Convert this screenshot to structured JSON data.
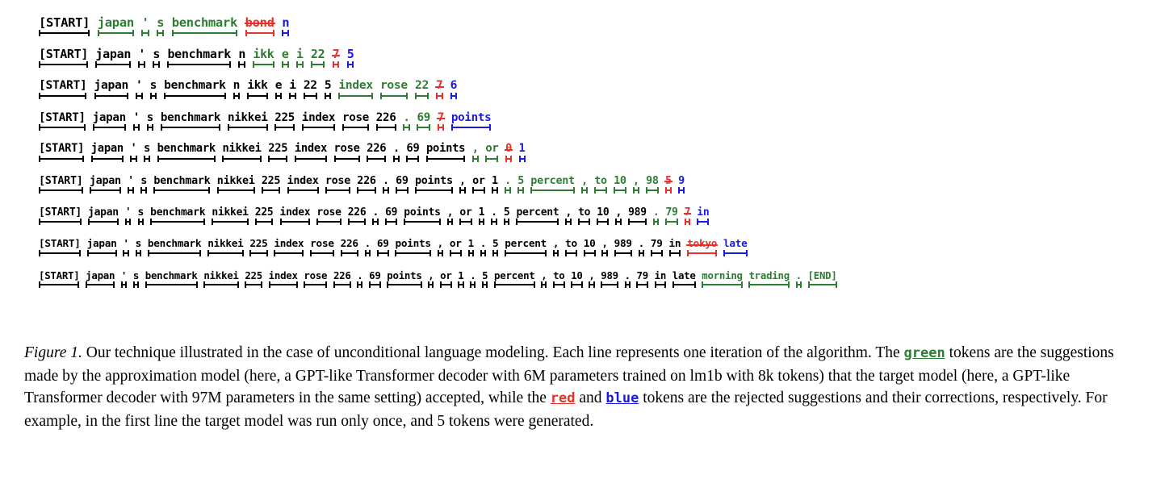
{
  "figure": {
    "label": "Figure 1.",
    "colors": {
      "accepted_green": "#2e7d32",
      "rejected_red": "#e8312a",
      "correction_blue": "#1a1ae0",
      "context_black": "#000000"
    },
    "rows": [
      {
        "index": 1,
        "font_size": 15.5,
        "tokens": [
          {
            "text": "[START]",
            "color": "black"
          },
          {
            "text": "japan",
            "color": "green"
          },
          {
            "text": "'",
            "color": "green"
          },
          {
            "text": "s",
            "color": "green"
          },
          {
            "text": "benchmark",
            "color": "green"
          },
          {
            "text": "bond",
            "color": "red",
            "strike": true
          },
          {
            "text": "n",
            "color": "blue"
          }
        ]
      },
      {
        "index": 2,
        "font_size": 15.0,
        "tokens": [
          {
            "text": "[START]",
            "color": "black"
          },
          {
            "text": "japan",
            "color": "black"
          },
          {
            "text": "'",
            "color": "black"
          },
          {
            "text": "s",
            "color": "black"
          },
          {
            "text": "benchmark",
            "color": "black"
          },
          {
            "text": "n",
            "color": "black"
          },
          {
            "text": "ikk",
            "color": "green"
          },
          {
            "text": "e",
            "color": "green"
          },
          {
            "text": "i",
            "color": "green"
          },
          {
            "text": "22",
            "color": "green"
          },
          {
            "text": "7",
            "color": "red",
            "strike": true
          },
          {
            "text": "5",
            "color": "blue"
          }
        ]
      },
      {
        "index": 3,
        "font_size": 14.6,
        "tokens": [
          {
            "text": "[START]",
            "color": "black"
          },
          {
            "text": "japan",
            "color": "black"
          },
          {
            "text": "'",
            "color": "black"
          },
          {
            "text": "s",
            "color": "black"
          },
          {
            "text": "benchmark",
            "color": "black"
          },
          {
            "text": "n",
            "color": "black"
          },
          {
            "text": "ikk",
            "color": "black"
          },
          {
            "text": "e",
            "color": "black"
          },
          {
            "text": "i",
            "color": "black"
          },
          {
            "text": "22",
            "color": "black"
          },
          {
            "text": "5",
            "color": "black"
          },
          {
            "text": "index",
            "color": "green"
          },
          {
            "text": "rose",
            "color": "green"
          },
          {
            "text": "22",
            "color": "green"
          },
          {
            "text": "7",
            "color": "red",
            "strike": true
          },
          {
            "text": "6",
            "color": "blue"
          }
        ]
      },
      {
        "index": 4,
        "font_size": 14.2,
        "tokens": [
          {
            "text": "[START]",
            "color": "black"
          },
          {
            "text": "japan",
            "color": "black"
          },
          {
            "text": "'",
            "color": "black"
          },
          {
            "text": "s",
            "color": "black"
          },
          {
            "text": "benchmark",
            "color": "black"
          },
          {
            "text": "nikkei",
            "color": "black"
          },
          {
            "text": "225",
            "color": "black"
          },
          {
            "text": "index",
            "color": "black"
          },
          {
            "text": "rose",
            "color": "black"
          },
          {
            "text": "226",
            "color": "black"
          },
          {
            "text": ".",
            "color": "green"
          },
          {
            "text": "69",
            "color": "green"
          },
          {
            "text": "7",
            "color": "red",
            "strike": true
          },
          {
            "text": "points",
            "color": "blue"
          }
        ]
      },
      {
        "index": 5,
        "font_size": 13.8,
        "tokens": [
          {
            "text": "[START]",
            "color": "black"
          },
          {
            "text": "japan",
            "color": "black"
          },
          {
            "text": "'",
            "color": "black"
          },
          {
            "text": "s",
            "color": "black"
          },
          {
            "text": "benchmark",
            "color": "black"
          },
          {
            "text": "nikkei",
            "color": "black"
          },
          {
            "text": "225",
            "color": "black"
          },
          {
            "text": "index",
            "color": "black"
          },
          {
            "text": "rose",
            "color": "black"
          },
          {
            "text": "226",
            "color": "black"
          },
          {
            "text": ".",
            "color": "black"
          },
          {
            "text": "69",
            "color": "black"
          },
          {
            "text": "points",
            "color": "black"
          },
          {
            "text": ",",
            "color": "green"
          },
          {
            "text": "or",
            "color": "green"
          },
          {
            "text": "0",
            "color": "red",
            "strike": true
          },
          {
            "text": "1",
            "color": "blue"
          }
        ]
      },
      {
        "index": 6,
        "font_size": 13.4,
        "tokens": [
          {
            "text": "[START]",
            "color": "black"
          },
          {
            "text": "japan",
            "color": "black"
          },
          {
            "text": "'",
            "color": "black"
          },
          {
            "text": "s",
            "color": "black"
          },
          {
            "text": "benchmark",
            "color": "black"
          },
          {
            "text": "nikkei",
            "color": "black"
          },
          {
            "text": "225",
            "color": "black"
          },
          {
            "text": "index",
            "color": "black"
          },
          {
            "text": "rose",
            "color": "black"
          },
          {
            "text": "226",
            "color": "black"
          },
          {
            "text": ".",
            "color": "black"
          },
          {
            "text": "69",
            "color": "black"
          },
          {
            "text": "points",
            "color": "black"
          },
          {
            "text": ",",
            "color": "black"
          },
          {
            "text": "or",
            "color": "black"
          },
          {
            "text": "1",
            "color": "black"
          },
          {
            "text": ".",
            "color": "green"
          },
          {
            "text": "5",
            "color": "green"
          },
          {
            "text": "percent",
            "color": "green"
          },
          {
            "text": ",",
            "color": "green"
          },
          {
            "text": "to",
            "color": "green"
          },
          {
            "text": "10",
            "color": "green"
          },
          {
            "text": ",",
            "color": "green"
          },
          {
            "text": "98",
            "color": "green"
          },
          {
            "text": "5",
            "color": "red",
            "strike": true
          },
          {
            "text": "9",
            "color": "blue"
          }
        ]
      },
      {
        "index": 7,
        "font_size": 13.0,
        "tokens": [
          {
            "text": "[START]",
            "color": "black"
          },
          {
            "text": "japan",
            "color": "black"
          },
          {
            "text": "'",
            "color": "black"
          },
          {
            "text": "s",
            "color": "black"
          },
          {
            "text": "benchmark",
            "color": "black"
          },
          {
            "text": "nikkei",
            "color": "black"
          },
          {
            "text": "225",
            "color": "black"
          },
          {
            "text": "index",
            "color": "black"
          },
          {
            "text": "rose",
            "color": "black"
          },
          {
            "text": "226",
            "color": "black"
          },
          {
            "text": ".",
            "color": "black"
          },
          {
            "text": "69",
            "color": "black"
          },
          {
            "text": "points",
            "color": "black"
          },
          {
            "text": ",",
            "color": "black"
          },
          {
            "text": "or",
            "color": "black"
          },
          {
            "text": "1",
            "color": "black"
          },
          {
            "text": ".",
            "color": "black"
          },
          {
            "text": "5",
            "color": "black"
          },
          {
            "text": "percent",
            "color": "black"
          },
          {
            "text": ",",
            "color": "black"
          },
          {
            "text": "to",
            "color": "black"
          },
          {
            "text": "10",
            "color": "black"
          },
          {
            "text": ",",
            "color": "black"
          },
          {
            "text": "989",
            "color": "black"
          },
          {
            "text": ".",
            "color": "green"
          },
          {
            "text": "79",
            "color": "green"
          },
          {
            "text": "7",
            "color": "red",
            "strike": true
          },
          {
            "text": "in",
            "color": "blue"
          }
        ]
      },
      {
        "index": 8,
        "font_size": 12.7,
        "tokens": [
          {
            "text": "[START]",
            "color": "black"
          },
          {
            "text": "japan",
            "color": "black"
          },
          {
            "text": "'",
            "color": "black"
          },
          {
            "text": "s",
            "color": "black"
          },
          {
            "text": "benchmark",
            "color": "black"
          },
          {
            "text": "nikkei",
            "color": "black"
          },
          {
            "text": "225",
            "color": "black"
          },
          {
            "text": "index",
            "color": "black"
          },
          {
            "text": "rose",
            "color": "black"
          },
          {
            "text": "226",
            "color": "black"
          },
          {
            "text": ".",
            "color": "black"
          },
          {
            "text": "69",
            "color": "black"
          },
          {
            "text": "points",
            "color": "black"
          },
          {
            "text": ",",
            "color": "black"
          },
          {
            "text": "or",
            "color": "black"
          },
          {
            "text": "1",
            "color": "black"
          },
          {
            "text": ".",
            "color": "black"
          },
          {
            "text": "5",
            "color": "black"
          },
          {
            "text": "percent",
            "color": "black"
          },
          {
            "text": ",",
            "color": "black"
          },
          {
            "text": "to",
            "color": "black"
          },
          {
            "text": "10",
            "color": "black"
          },
          {
            "text": ",",
            "color": "black"
          },
          {
            "text": "989",
            "color": "black"
          },
          {
            "text": ".",
            "color": "black"
          },
          {
            "text": "79",
            "color": "black"
          },
          {
            "text": "in",
            "color": "black"
          },
          {
            "text": "tokyo",
            "color": "red",
            "strike": true
          },
          {
            "text": "late",
            "color": "blue"
          }
        ]
      },
      {
        "index": 9,
        "font_size": 12.4,
        "tokens": [
          {
            "text": "[START]",
            "color": "black"
          },
          {
            "text": "japan",
            "color": "black"
          },
          {
            "text": "'",
            "color": "black"
          },
          {
            "text": "s",
            "color": "black"
          },
          {
            "text": "benchmark",
            "color": "black"
          },
          {
            "text": "nikkei",
            "color": "black"
          },
          {
            "text": "225",
            "color": "black"
          },
          {
            "text": "index",
            "color": "black"
          },
          {
            "text": "rose",
            "color": "black"
          },
          {
            "text": "226",
            "color": "black"
          },
          {
            "text": ".",
            "color": "black"
          },
          {
            "text": "69",
            "color": "black"
          },
          {
            "text": "points",
            "color": "black"
          },
          {
            "text": ",",
            "color": "black"
          },
          {
            "text": "or",
            "color": "black"
          },
          {
            "text": "1",
            "color": "black"
          },
          {
            "text": ".",
            "color": "black"
          },
          {
            "text": "5",
            "color": "black"
          },
          {
            "text": "percent",
            "color": "black"
          },
          {
            "text": ",",
            "color": "black"
          },
          {
            "text": "to",
            "color": "black"
          },
          {
            "text": "10",
            "color": "black"
          },
          {
            "text": ",",
            "color": "black"
          },
          {
            "text": "989",
            "color": "black"
          },
          {
            "text": ".",
            "color": "black"
          },
          {
            "text": "79",
            "color": "black"
          },
          {
            "text": "in",
            "color": "black"
          },
          {
            "text": "late",
            "color": "black"
          },
          {
            "text": "morning",
            "color": "green"
          },
          {
            "text": "trading",
            "color": "green"
          },
          {
            "text": ".",
            "color": "green"
          },
          {
            "text": "[END]",
            "color": "green"
          }
        ]
      }
    ]
  },
  "caption": {
    "label": "Figure 1.",
    "part1": " Our technique illustrated in the case of unconditional language modeling. Each line represents one iteration of the algorithm. The ",
    "green_word": "green",
    "part2": " tokens are the suggestions made by the approximation model (here, a GPT-like Transformer decoder with 6M parameters trained on lm1b with 8k tokens) that the target model (here, a GPT-like Transformer decoder with 97M parameters in the same setting) accepted, while the ",
    "red_word": "red",
    "part3": " and ",
    "blue_word": "blue",
    "part4": " tokens are the rejected suggestions and their corrections, respectively. For example, in the first line the target model was run only once, and 5 tokens were generated."
  }
}
